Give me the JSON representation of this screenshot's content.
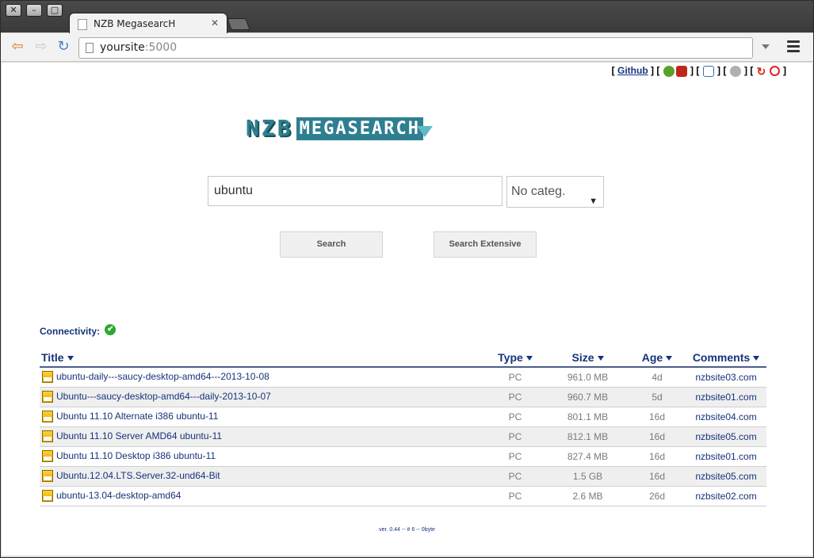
{
  "browser": {
    "tab_title": "NZB MegasearcH",
    "url_host": "yoursite",
    "url_port": ":5000"
  },
  "toplinks": {
    "github_label": "Github"
  },
  "logo": {
    "part1": "NZB",
    "part2": "MEGASEARCH"
  },
  "search": {
    "query": "ubuntu",
    "category": "No categ.",
    "search_button": "Search",
    "search_ext_button": "Search Extensive"
  },
  "connectivity_label": "Connectivity:",
  "table": {
    "headers": {
      "title": "Title",
      "type": "Type",
      "size": "Size",
      "age": "Age",
      "comments": "Comments"
    },
    "rows": [
      {
        "title": "ubuntu-daily---saucy-desktop-amd64---2013-10-08",
        "type": "PC",
        "size": "961.0 MB",
        "age": "4d",
        "comments": "nzbsite03.com"
      },
      {
        "title": "Ubuntu---saucy-desktop-amd64---daily-2013-10-07",
        "type": "PC",
        "size": "960.7 MB",
        "age": "5d",
        "comments": "nzbsite01.com"
      },
      {
        "title": "Ubuntu 11.10 Alternate i386 ubuntu-11",
        "type": "PC",
        "size": "801.1 MB",
        "age": "16d",
        "comments": "nzbsite04.com"
      },
      {
        "title": "Ubuntu 11.10 Server AMD64 ubuntu-11",
        "type": "PC",
        "size": "812.1 MB",
        "age": "16d",
        "comments": "nzbsite05.com"
      },
      {
        "title": "Ubuntu 11.10 Desktop i386 ubuntu-11",
        "type": "PC",
        "size": "827.4 MB",
        "age": "16d",
        "comments": "nzbsite01.com"
      },
      {
        "title": "Ubuntu.12.04.LTS.Server.32-und64-Bit",
        "type": "PC",
        "size": "1.5 GB",
        "age": "16d",
        "comments": "nzbsite05.com"
      },
      {
        "title": "ubuntu-13.04-desktop-amd64",
        "type": "PC",
        "size": "2.6 MB",
        "age": "26d",
        "comments": "nzbsite02.com"
      }
    ]
  },
  "footer": "ver. 0.44 -- # 6 -- 0byte"
}
